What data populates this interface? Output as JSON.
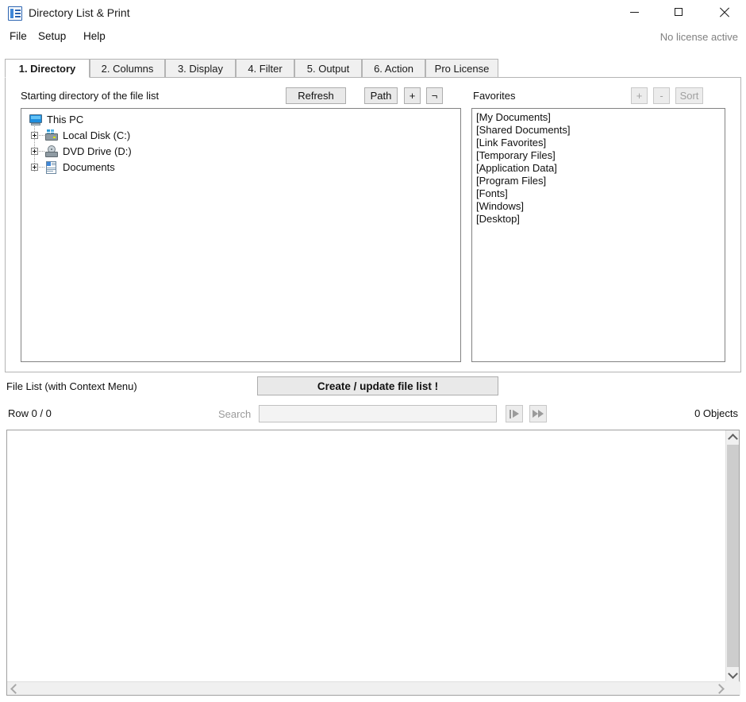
{
  "window": {
    "title": "Directory List & Print",
    "icon": "app-list-icon",
    "controls": {
      "minimize": "minimize-icon",
      "maximize": "maximize-icon",
      "close": "close-icon"
    }
  },
  "menu": {
    "items": [
      "File",
      "Setup",
      "Help"
    ]
  },
  "license_status": "No license active",
  "tabs": [
    {
      "label": "1. Directory",
      "active": true
    },
    {
      "label": "2. Columns",
      "active": false
    },
    {
      "label": "3. Display",
      "active": false
    },
    {
      "label": "4. Filter",
      "active": false
    },
    {
      "label": "5. Output",
      "active": false
    },
    {
      "label": "6. Action",
      "active": false
    },
    {
      "label": "Pro License",
      "active": false
    }
  ],
  "directory_panel": {
    "label": "Starting directory of the file list",
    "buttons": {
      "refresh": "Refresh",
      "path": "Path",
      "plus": "+",
      "not": "¬"
    },
    "tree": [
      {
        "label": "This PC",
        "icon": "computer-icon",
        "level": 0,
        "expandable": false
      },
      {
        "label": "Local Disk (C:)",
        "icon": "hard-drive-icon",
        "level": 1,
        "expandable": true
      },
      {
        "label": "DVD Drive (D:)",
        "icon": "dvd-drive-icon",
        "level": 1,
        "expandable": true
      },
      {
        "label": "Documents",
        "icon": "documents-icon",
        "level": 1,
        "expandable": true
      }
    ]
  },
  "favorites_panel": {
    "label": "Favorites",
    "buttons": {
      "add": "+",
      "remove": "-",
      "sort": "Sort"
    },
    "items": [
      "[My Documents]",
      "[Shared Documents]",
      "[Link Favorites]",
      "[Temporary Files]",
      "[Application Data]",
      "[Program Files]",
      "[Fonts]",
      "[Windows]",
      "[Desktop]"
    ]
  },
  "file_list_section": {
    "label": "File List (with Context Menu)",
    "create_button": "Create / update file list !",
    "row_counter": "Row 0 / 0",
    "search_label": "Search",
    "search_value": "",
    "search_placeholder": "",
    "nav_first": "play-from-start-icon",
    "nav_next": "fast-forward-icon",
    "object_count": "0 Objects"
  },
  "colors": {
    "accent": "#2a63b0",
    "window_bg": "#ffffff",
    "panel_border": "#b4b4b4",
    "button_face": "#e9e9e9",
    "disabled_text": "#a0a0a0"
  }
}
